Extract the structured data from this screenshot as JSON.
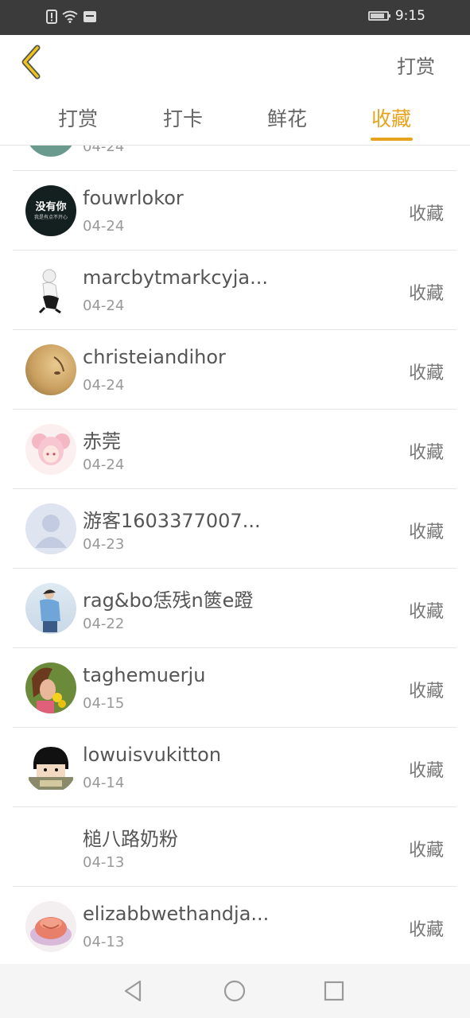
{
  "status": {
    "time": "9:15"
  },
  "topbar": {
    "reward_label": "打赏"
  },
  "tabs": [
    {
      "label": "打赏",
      "active": false
    },
    {
      "label": "打卡",
      "active": false
    },
    {
      "label": "鲜花",
      "active": false
    },
    {
      "label": "收藏",
      "active": true
    }
  ],
  "colors": {
    "accent": "#e8a31e",
    "text": "#555555",
    "muted": "#999999"
  },
  "list": {
    "partial_row_date": "04-24",
    "rows": [
      {
        "name": "fouwrlokor",
        "date": "04-24",
        "action": "收藏",
        "avatar_text": "没有你\n我是有点不开心"
      },
      {
        "name": "marcbytmarkcyja...",
        "date": "04-24",
        "action": "收藏"
      },
      {
        "name": "christeiandihor",
        "date": "04-24",
        "action": "收藏"
      },
      {
        "name": "赤莞",
        "date": "04-24",
        "action": "收藏"
      },
      {
        "name": "游客1603377007...",
        "date": "04-23",
        "action": "收藏"
      },
      {
        "name": "rag&bo恁残n篋e蹬",
        "date": "04-22",
        "action": "收藏"
      },
      {
        "name": "taghemuerju",
        "date": "04-15",
        "action": "收藏"
      },
      {
        "name": "lowuisvukitton",
        "date": "04-14",
        "action": "收藏"
      },
      {
        "name": "槌八路奶粉",
        "date": "04-13",
        "action": "收藏"
      },
      {
        "name": "elizabbwethandja...",
        "date": "04-13",
        "action": "收藏"
      }
    ]
  }
}
